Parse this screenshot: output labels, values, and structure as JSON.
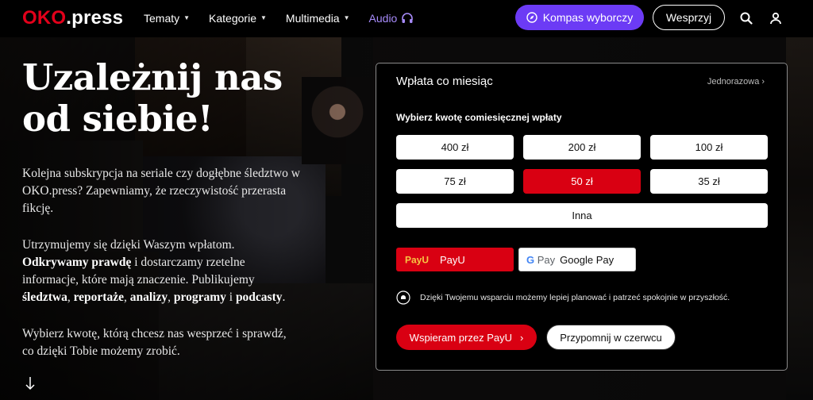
{
  "header": {
    "logo_main": "OKO",
    "logo_suffix": ".press",
    "nav": [
      {
        "label": "Tematy"
      },
      {
        "label": "Kategorie"
      },
      {
        "label": "Multimedia"
      },
      {
        "label": "Audio"
      }
    ],
    "kompas_label": "Kompas wyborczy",
    "support_label": "Wesprzyj"
  },
  "hero": {
    "headline_line1": "Uzależnij nas",
    "headline_line2": "od siebie!",
    "p1": "Kolejna subskrypcja na seriale czy dogłębne śledztwo w OKO.press? Zapewniamy, że rzeczywistość przerasta fikcję.",
    "p2": {
      "t1": "Utrzymujemy się dzięki Waszym wpłatom.",
      "b1": "Odkrywamy prawdę",
      "t2": " i dostarczamy rzetelne informacje, które mają znaczenie. Publikujemy ",
      "b2": "śledztwa",
      "t3": ", ",
      "b3": "reportaże",
      "t4": ", ",
      "b4": "analizy",
      "t5": ", ",
      "b5": "programy",
      "t6": " i ",
      "b6": "podcasty",
      "t7": "."
    },
    "p3": "Wybierz kwotę, którą chcesz nas wesprzeć i sprawdź, co dzięki Tobie możemy zrobić."
  },
  "donation": {
    "title": "Wpłata co miesiąc",
    "one_time_label": "Jednorazowa",
    "select_label": "Wybierz kwotę comiesięcznej wpłaty",
    "amounts": [
      "400 zł",
      "200 zł",
      "100 zł",
      "75 zł",
      "50 zł",
      "35 zł",
      "Inna"
    ],
    "selected_amount": "50 zł",
    "payu_label": "PayU",
    "payu_logo": "PayU",
    "gpay_label": "Google Pay",
    "gpay_logo_g": "G",
    "gpay_logo_pay": "Pay",
    "note": "Dzięki Twojemu wsparciu możemy lepiej planować i patrzeć spokojnie w przyszłość.",
    "cta_label": "Wspieram przez PayU",
    "remind_label": "Przypomnij w czerwcu"
  },
  "colors": {
    "brand_red": "#d90012",
    "kompas_purple": "#6c3bf5",
    "audio_purple": "#a78bfa"
  }
}
